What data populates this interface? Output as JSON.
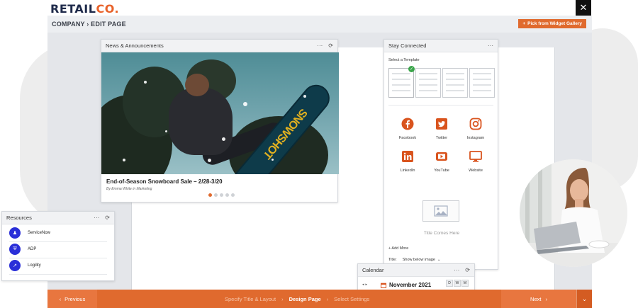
{
  "brand": {
    "logo_text": "RETAIL",
    "logo_accent": "CO.",
    "accent_color": "#e06a2e",
    "navy": "#1e2a4a"
  },
  "header": {
    "breadcrumb": "COMPANY › EDIT PAGE",
    "gallery_button": "Pick from Widget Gallery",
    "gallery_icon": "plus-icon",
    "close_icon": "close-icon",
    "close_glyph": "✕"
  },
  "news_widget": {
    "title": "News & Announcements",
    "menu_glyph": "···",
    "refresh_glyph": "⟳",
    "article_title": "End-of-Season Snowboard Sale – 2/28-3/20",
    "byline": "By Emma White in Marketing",
    "board_text": "SNOWSHOT",
    "slide_count": 5,
    "active_slide": 1
  },
  "stay_connected": {
    "title": "Stay Connected",
    "menu_glyph": "···",
    "template_label": "Select a Template",
    "check_glyph": "✓",
    "social": [
      {
        "label": "Facebook",
        "icon": "facebook-icon"
      },
      {
        "label": "Twitter",
        "icon": "twitter-icon"
      },
      {
        "label": "Instagram",
        "icon": "instagram-icon"
      },
      {
        "label": "LinkedIn",
        "icon": "linkedin-icon"
      },
      {
        "label": "YouTube",
        "icon": "youtube-icon"
      },
      {
        "label": "Website",
        "icon": "website-icon"
      }
    ],
    "title_placeholder": "Title Comes Here",
    "add_more": "+ Add More",
    "title_label": "Title:",
    "title_select": "Show below image",
    "chevron": "⌄"
  },
  "resources": {
    "title": "Resources",
    "menu_glyph": "···",
    "refresh_glyph": "⟳",
    "items": [
      {
        "label": "ServiceNow",
        "icon": "person-icon",
        "glyph": "♟"
      },
      {
        "label": "ADP",
        "icon": "shield-icon",
        "glyph": "⛨"
      },
      {
        "label": "Logility",
        "icon": "chart-icon",
        "glyph": "↗"
      }
    ]
  },
  "calendar": {
    "title": "Calendar",
    "menu_glyph": "···",
    "refresh_glyph": "⟳",
    "prev_glyph": "◂",
    "next_glyph": "▸",
    "month": "November 2021",
    "views": [
      "D",
      "W",
      "M"
    ]
  },
  "footer": {
    "prev_arrow": "‹",
    "prev_label": "Previous",
    "steps": [
      "Specify Title & Layout",
      "Design Page",
      "Select Settings"
    ],
    "step_sep": "›",
    "active_step": 1,
    "next_label": "Next",
    "next_arrow": "›",
    "menu_glyph": "⌄"
  }
}
